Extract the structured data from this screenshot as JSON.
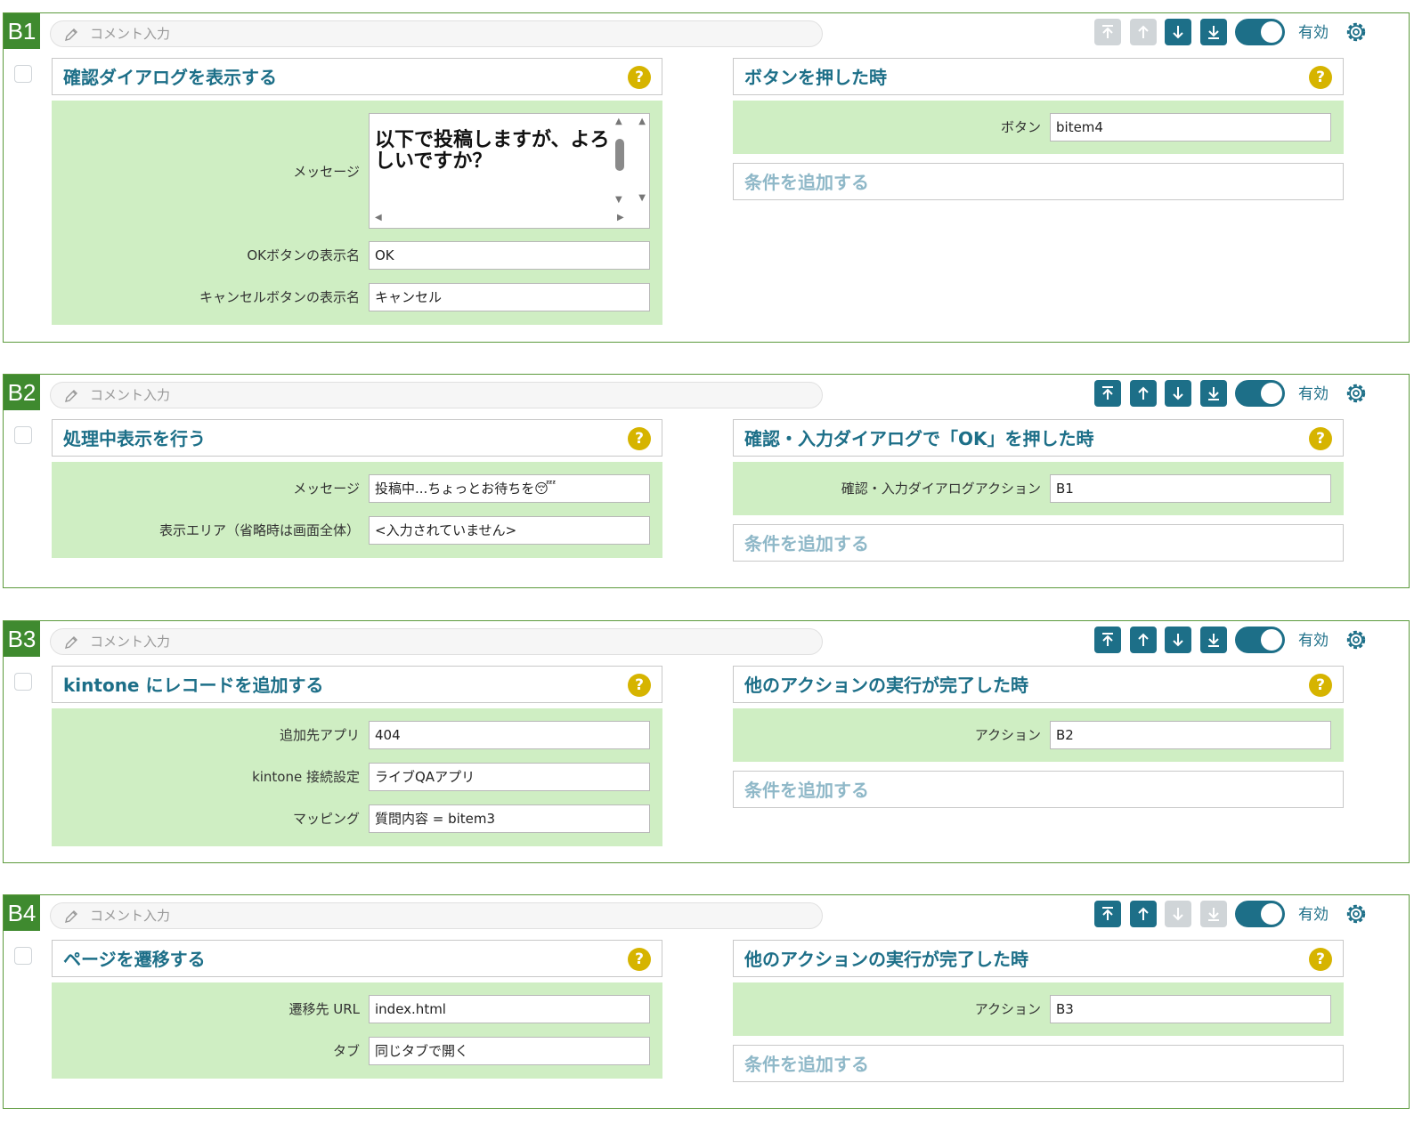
{
  "common": {
    "comment_placeholder": "コメント入力",
    "enabled_label": "有効",
    "add_condition_label": "条件を追加する",
    "help_label": "?"
  },
  "colors": {
    "accent": "#1d6f88",
    "block_id_bg": "#3f8a2f",
    "panel_bg": "#cfeec3",
    "help": "#d6b400"
  },
  "blocks": [
    {
      "id": "B1",
      "controls": {
        "top": "disabled",
        "up": "disabled",
        "down": "enabled",
        "bottom": "enabled"
      },
      "action": {
        "title": "確認ダイアログを表示する",
        "fields": [
          {
            "label": "メッセージ",
            "value": "以下で投稿しますが、よろしいですか？"
          },
          {
            "label": "OKボタンの表示名",
            "value": "OK"
          },
          {
            "label": "キャンセルボタンの表示名",
            "value": "キャンセル"
          }
        ]
      },
      "trigger": {
        "title": "ボタンを押した時",
        "fields": [
          {
            "label": "ボタン",
            "value": "bitem4"
          }
        ]
      }
    },
    {
      "id": "B2",
      "controls": {
        "top": "enabled",
        "up": "enabled",
        "down": "enabled",
        "bottom": "enabled"
      },
      "action": {
        "title": "処理中表示を行う",
        "fields": [
          {
            "label": "メッセージ",
            "value": "投稿中...ちょっとお待ちを😴"
          },
          {
            "label": "表示エリア（省略時は画面全体）",
            "value": "<入力されていません>"
          }
        ]
      },
      "trigger": {
        "title": "確認・入力ダイアログで「OK」を押した時",
        "fields": [
          {
            "label": "確認・入力ダイアログアクション",
            "value": "B1"
          }
        ]
      }
    },
    {
      "id": "B3",
      "controls": {
        "top": "enabled",
        "up": "enabled",
        "down": "enabled",
        "bottom": "enabled"
      },
      "action": {
        "title": "kintone にレコードを追加する",
        "fields": [
          {
            "label": "追加先アプリ",
            "value": "404"
          },
          {
            "label": "kintone 接続設定",
            "value": "ライブQAアプリ"
          },
          {
            "label": "マッピング",
            "value": "質問内容 = bitem3"
          }
        ]
      },
      "trigger": {
        "title": "他のアクションの実行が完了した時",
        "fields": [
          {
            "label": "アクション",
            "value": "B2"
          }
        ]
      }
    },
    {
      "id": "B4",
      "controls": {
        "top": "enabled",
        "up": "enabled",
        "down": "disabled",
        "bottom": "disabled"
      },
      "action": {
        "title": "ページを遷移する",
        "fields": [
          {
            "label": "遷移先 URL",
            "value": "index.html"
          },
          {
            "label": "タブ",
            "value": "同じタブで開く"
          }
        ]
      },
      "trigger": {
        "title": "他のアクションの実行が完了した時",
        "fields": [
          {
            "label": "アクション",
            "value": "B3"
          }
        ]
      }
    }
  ]
}
